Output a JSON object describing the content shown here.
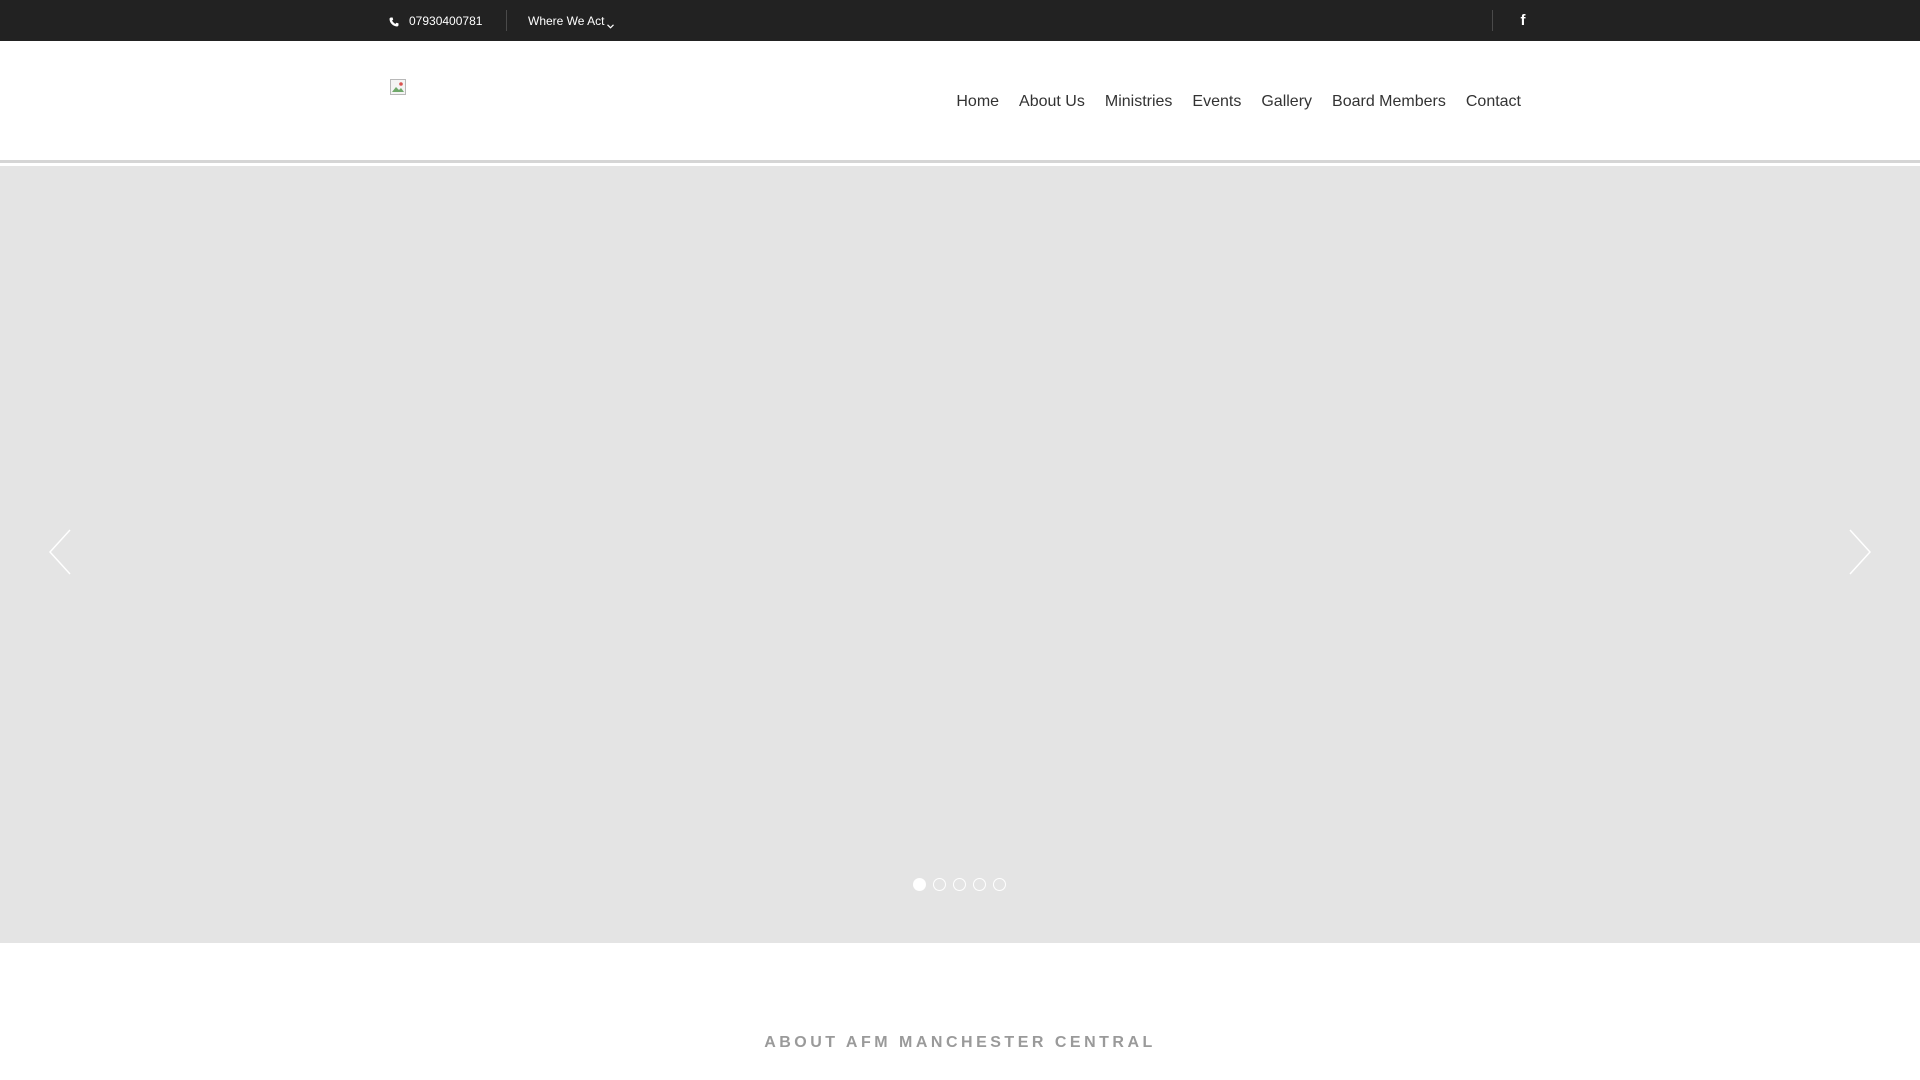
{
  "topbar": {
    "phone": "07930400781",
    "where_label": "Where We Act",
    "social": "f"
  },
  "nav": {
    "items": [
      {
        "label": "Home"
      },
      {
        "label": "About Us"
      },
      {
        "label": "Ministries"
      },
      {
        "label": "Events"
      },
      {
        "label": "Gallery"
      },
      {
        "label": "Board Members"
      },
      {
        "label": "Contact"
      }
    ]
  },
  "slider": {
    "slide_count": 5,
    "active_slide": 1
  },
  "about": {
    "title": "ABOUT AFM MANCHESTER CENTRAL"
  },
  "colors": {
    "topbar_bg": "#222222",
    "hero_bg": "#e4e4e4",
    "nav_text": "#333333",
    "about_title": "#9a9a9a"
  }
}
